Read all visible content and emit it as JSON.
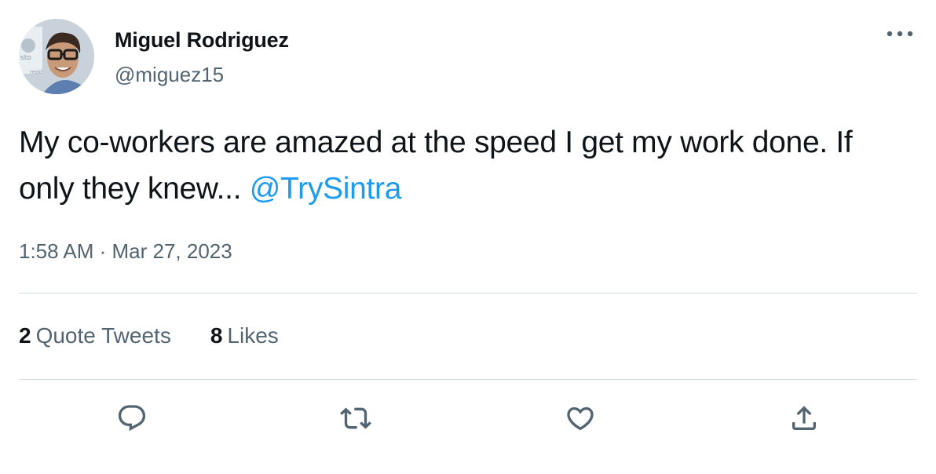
{
  "author": {
    "name": "Miguel Rodriguez",
    "handle": "@miguez15",
    "avatar_alt": "Miguel Rodriguez"
  },
  "tweet": {
    "text": "My co-workers are amazed at the speed I get my work done. If only they knew... ",
    "mention": "@TrySintra",
    "timestamp": "1:58 AM · Mar 27, 2023"
  },
  "stats": {
    "quote_tweets_count": "2",
    "quote_tweets_label": "Quote Tweets",
    "likes_count": "8",
    "likes_label": "Likes"
  },
  "icons": {
    "more": "more-horizontal-icon",
    "reply": "reply-icon",
    "retweet": "retweet-icon",
    "like": "heart-icon",
    "share": "share-icon"
  },
  "colors": {
    "text": "#0f1419",
    "secondary": "#536471",
    "accent": "#1d9bf0",
    "divider": "#cfd9de"
  }
}
